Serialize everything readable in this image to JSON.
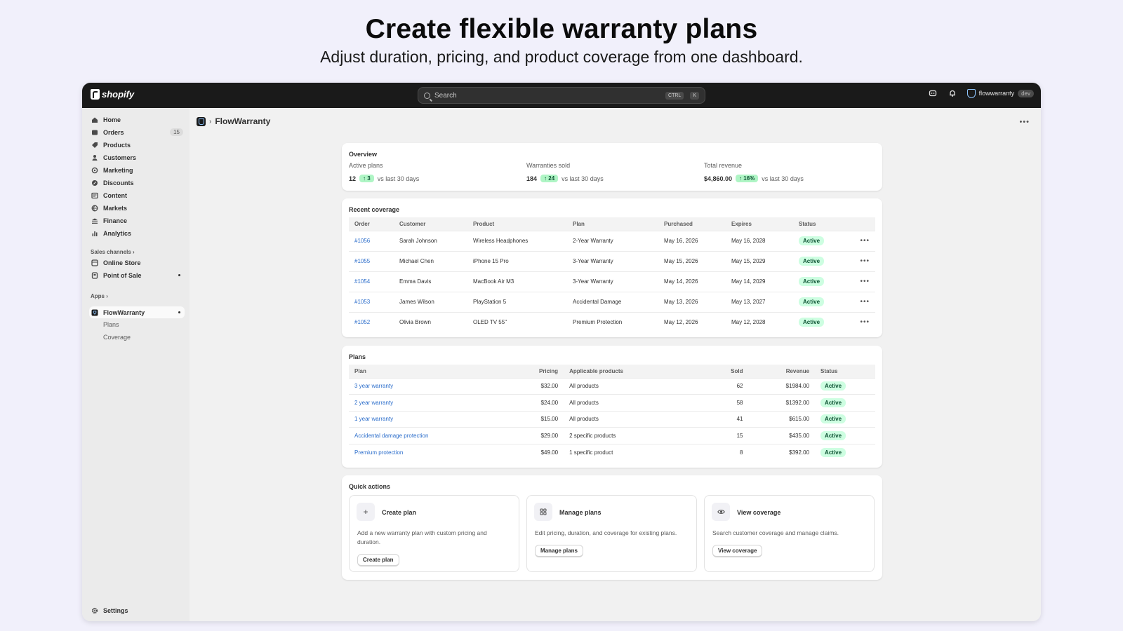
{
  "hero": {
    "title": "Create flexible warranty plans",
    "subtitle": "Adjust duration, pricing, and product coverage from one dashboard."
  },
  "topbar": {
    "brand": "shopify",
    "search_placeholder": "Search",
    "kbd_ctrl": "CTRL",
    "kbd_k": "K",
    "store_name": "flowwarranty",
    "store_badge": "dev"
  },
  "sidebar": {
    "items": [
      {
        "label": "Home",
        "icon": "home-icon"
      },
      {
        "label": "Orders",
        "icon": "orders-icon",
        "badge": "15"
      },
      {
        "label": "Products",
        "icon": "products-icon"
      },
      {
        "label": "Customers",
        "icon": "customers-icon"
      },
      {
        "label": "Marketing",
        "icon": "marketing-icon"
      },
      {
        "label": "Discounts",
        "icon": "discounts-icon"
      },
      {
        "label": "Content",
        "icon": "content-icon"
      },
      {
        "label": "Markets",
        "icon": "markets-icon"
      },
      {
        "label": "Finance",
        "icon": "finance-icon"
      },
      {
        "label": "Analytics",
        "icon": "analytics-icon"
      }
    ],
    "sales_channels_label": "Sales channels",
    "channels": [
      {
        "label": "Online Store"
      },
      {
        "label": "Point of Sale"
      }
    ],
    "apps_label": "Apps",
    "app": {
      "label": "FlowWarranty"
    },
    "app_subitems": [
      "Plans",
      "Coverage"
    ],
    "settings_label": "Settings"
  },
  "page": {
    "title": "FlowWarranty"
  },
  "overview": {
    "title": "Overview",
    "stats": [
      {
        "label": "Active plans",
        "value": "12",
        "change": "3",
        "compare": "vs last 30 days"
      },
      {
        "label": "Warranties sold",
        "value": "184",
        "change": "24",
        "compare": "vs last 30 days"
      },
      {
        "label": "Total revenue",
        "value": "$4,860.00",
        "change": "16%",
        "compare": "vs last 30 days"
      }
    ]
  },
  "recent": {
    "title": "Recent coverage",
    "headers": [
      "Order",
      "Customer",
      "Product",
      "Plan",
      "Purchased",
      "Expires",
      "Status"
    ],
    "rows": [
      {
        "order": "#1056",
        "customer": "Sarah Johnson",
        "product": "Wireless Headphones",
        "plan": "2-Year Warranty",
        "purchased": "May 16, 2026",
        "expires": "May 16, 2028",
        "status": "Active"
      },
      {
        "order": "#1055",
        "customer": "Michael Chen",
        "product": "iPhone 15 Pro",
        "plan": "3-Year Warranty",
        "purchased": "May 15, 2026",
        "expires": "May 15, 2029",
        "status": "Active"
      },
      {
        "order": "#1054",
        "customer": "Emma Davis",
        "product": "MacBook Air M3",
        "plan": "3-Year Warranty",
        "purchased": "May 14, 2026",
        "expires": "May 14, 2029",
        "status": "Active"
      },
      {
        "order": "#1053",
        "customer": "James Wilson",
        "product": "PlayStation 5",
        "plan": "Accidental Damage",
        "purchased": "May 13, 2026",
        "expires": "May 13, 2027",
        "status": "Active"
      },
      {
        "order": "#1052",
        "customer": "Olivia Brown",
        "product": "OLED TV 55\"",
        "plan": "Premium Protection",
        "purchased": "May 12, 2026",
        "expires": "May 12, 2028",
        "status": "Active"
      }
    ]
  },
  "plans": {
    "title": "Plans",
    "headers": [
      "Plan",
      "Pricing",
      "Applicable products",
      "Sold",
      "Revenue",
      "Status"
    ],
    "rows": [
      {
        "plan": "3 year warranty",
        "pricing": "$32.00",
        "products": "All products",
        "sold": "62",
        "revenue": "$1984.00",
        "status": "Active"
      },
      {
        "plan": "2 year warranty",
        "pricing": "$24.00",
        "products": "All products",
        "sold": "58",
        "revenue": "$1392.00",
        "status": "Active"
      },
      {
        "plan": "1 year warranty",
        "pricing": "$15.00",
        "products": "All products",
        "sold": "41",
        "revenue": "$615.00",
        "status": "Active"
      },
      {
        "plan": "Accidental damage protection",
        "pricing": "$29.00",
        "products": "2 specific products",
        "sold": "15",
        "revenue": "$435.00",
        "status": "Active"
      },
      {
        "plan": "Premium protection",
        "pricing": "$49.00",
        "products": "1 specific product",
        "sold": "8",
        "revenue": "$392.00",
        "status": "Active"
      }
    ]
  },
  "quick": {
    "title": "Quick actions",
    "actions": [
      {
        "title": "Create plan",
        "desc": "Add a new warranty plan with custom pricing and duration.",
        "button": "Create plan",
        "icon": "plus-icon"
      },
      {
        "title": "Manage plans",
        "desc": "Edit pricing, duration, and coverage for existing plans.",
        "button": "Manage plans",
        "icon": "grid-icon"
      },
      {
        "title": "View coverage",
        "desc": "Search customer coverage and manage claims.",
        "button": "View coverage",
        "icon": "eye-icon"
      }
    ]
  }
}
